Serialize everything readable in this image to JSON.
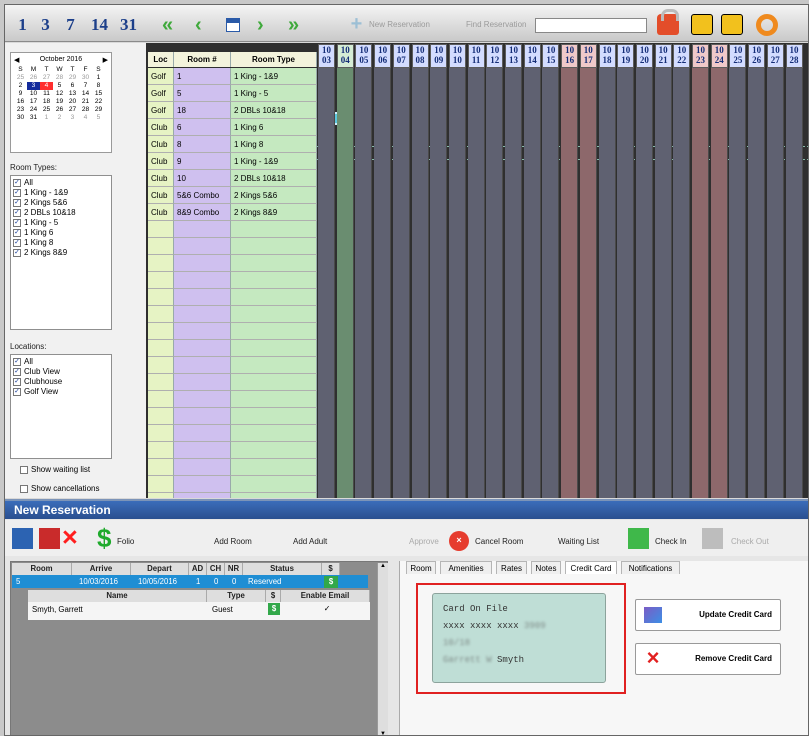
{
  "toolbar": {
    "views": [
      "1",
      "3",
      "7",
      "14",
      "31"
    ],
    "new_reservation": "New Reservation",
    "find_reservation": "Find Reservation"
  },
  "calendar": {
    "month": "October 2016",
    "weekdays": [
      "S",
      "M",
      "T",
      "W",
      "T",
      "F",
      "S"
    ],
    "weeks": [
      [
        "25",
        "26",
        "27",
        "28",
        "29",
        "30",
        "1"
      ],
      [
        "2",
        "3",
        "4",
        "5",
        "6",
        "7",
        "8"
      ],
      [
        "9",
        "10",
        "11",
        "12",
        "13",
        "14",
        "15"
      ],
      [
        "16",
        "17",
        "18",
        "19",
        "20",
        "21",
        "22"
      ],
      [
        "23",
        "24",
        "25",
        "26",
        "27",
        "28",
        "29"
      ],
      [
        "30",
        "31",
        "1",
        "2",
        "3",
        "4",
        "5"
      ]
    ]
  },
  "room_types": {
    "label": "Room Types:",
    "items": [
      "All",
      "1 King - 1&9",
      "2 Kings 5&6",
      "2 DBLs 10&18",
      "1 King - 5",
      "1 King 6",
      "1 King 8",
      "2 Kings 8&9"
    ]
  },
  "locations": {
    "label": "Locations:",
    "items": [
      "All",
      "Club View",
      "Clubhouse",
      "Golf View"
    ]
  },
  "options": {
    "waiting": "Show waiting list",
    "cancellations": "Show cancellations"
  },
  "grid": {
    "headers": {
      "loc": "Loc",
      "room": "Room #",
      "type": "Room Type"
    },
    "rows": [
      {
        "loc": "Golf",
        "room": "1",
        "type": "1 King - 1&9"
      },
      {
        "loc": "Golf",
        "room": "5",
        "type": "1 King - 5"
      },
      {
        "loc": "Golf",
        "room": "18",
        "type": "2 DBLs 10&18"
      },
      {
        "loc": "Club",
        "room": "6",
        "type": "1 King 6"
      },
      {
        "loc": "Club",
        "room": "8",
        "type": "1 King 8"
      },
      {
        "loc": "Club",
        "room": "9",
        "type": "1 King - 1&9"
      },
      {
        "loc": "Club",
        "room": "10",
        "type": "2 DBLs 10&18"
      },
      {
        "loc": "Club",
        "room": "5&6 Combo",
        "type": "2 Kings 5&6"
      },
      {
        "loc": "Club",
        "room": "8&9 Combo",
        "type": "2 Kings 8&9"
      }
    ],
    "months": [
      "10",
      "10",
      "10",
      "10",
      "10",
      "10",
      "10",
      "10",
      "10",
      "10",
      "10",
      "10",
      "10",
      "10",
      "10",
      "10",
      "10",
      "10",
      "10",
      "10",
      "10",
      "10",
      "10",
      "10",
      "10",
      "10"
    ],
    "days": [
      "03",
      "04",
      "05",
      "06",
      "07",
      "08",
      "09",
      "10",
      "11",
      "12",
      "13",
      "14",
      "15",
      "16",
      "17",
      "18",
      "19",
      "20",
      "21",
      "22",
      "23",
      "24",
      "25",
      "26",
      "27",
      "28"
    ]
  },
  "new_res": {
    "title": "New Reservation",
    "buttons": {
      "folio": "Folio",
      "add_room": "Add Room",
      "add_adult": "Add Adult",
      "approve": "Approve",
      "cancel_room": "Cancel Room",
      "waiting_list": "Waiting List",
      "check_in": "Check In",
      "check_out": "Check Out"
    },
    "table": {
      "headers": [
        "Room",
        "Arrive",
        "Depart",
        "AD",
        "CH",
        "NR",
        "Status",
        "$"
      ],
      "row": [
        "5",
        "10/03/2016",
        "10/05/2016",
        "1",
        "0",
        "0",
        "Reserved"
      ],
      "guest_headers": [
        "Name",
        "Type",
        "$",
        "Enable Email"
      ],
      "guest": [
        "Smyth, Garrett",
        "Guest"
      ]
    },
    "tabs": [
      "Room",
      "Amenities",
      "Rates",
      "Notes",
      "Credit Card",
      "Notifications"
    ],
    "card": {
      "title": "Card On File",
      "number": "xxxx xxxx xxxx",
      "last": "3909",
      "exp": "10/18",
      "name_first": "Garrett",
      "name_mid": "W",
      "name_last": "Smyth"
    },
    "actions": {
      "update": "Update Credit Card",
      "remove": "Remove Credit Card"
    }
  }
}
